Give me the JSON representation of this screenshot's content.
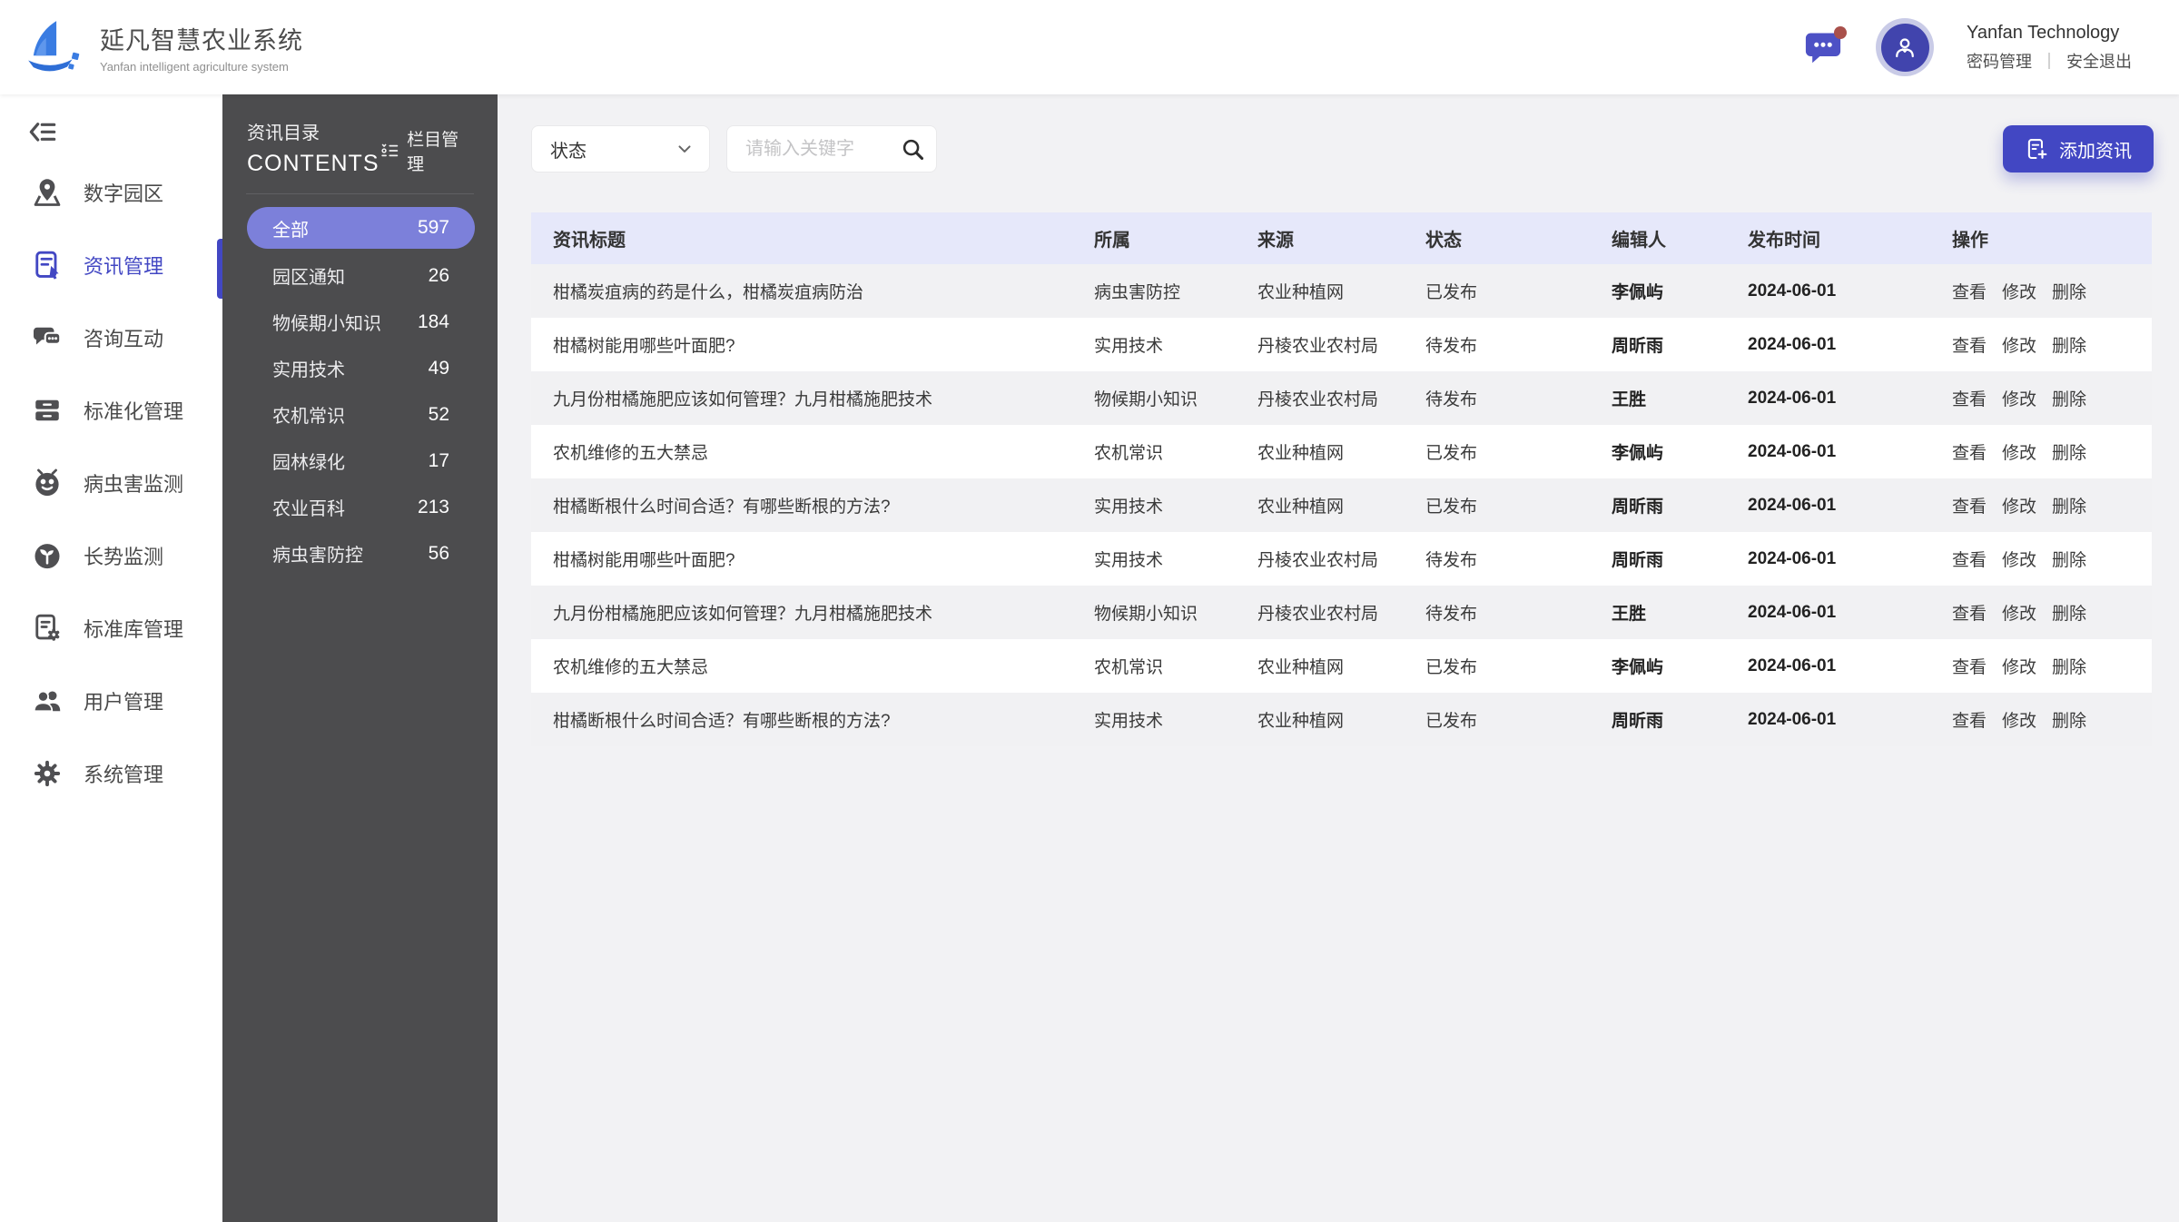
{
  "app": {
    "title": "延凡智慧农业系统",
    "subtitle": "Yanfan intelligent agriculture system",
    "company": "Yanfan Technology",
    "password_label": "密码管理",
    "separator": "｜",
    "logout_label": "安全退出",
    "message_icon": "message-icon",
    "avatar_icon": "user-avatar-icon"
  },
  "sidebar": {
    "collapse_icon": "collapse-menu-icon",
    "items": [
      {
        "label": "数字园区",
        "icon": "map-icon",
        "active": false
      },
      {
        "label": "资讯管理",
        "icon": "news-icon",
        "active": true
      },
      {
        "label": "咨询互动",
        "icon": "chat-icon",
        "active": false
      },
      {
        "label": "标准化管理",
        "icon": "archive-icon",
        "active": false
      },
      {
        "label": "病虫害监测",
        "icon": "bug-icon",
        "active": false
      },
      {
        "label": "长势监测",
        "icon": "sprout-icon",
        "active": false
      },
      {
        "label": "标准库管理",
        "icon": "doc-gear-icon",
        "active": false
      },
      {
        "label": "用户管理",
        "icon": "users-icon",
        "active": false
      },
      {
        "label": "系统管理",
        "icon": "gear-icon",
        "active": false
      }
    ]
  },
  "contents_panel": {
    "title_cn": "资讯目录",
    "title_en": "CONTENTS",
    "manage_label": "栏目管理",
    "manage_icon": "column-manage-icon",
    "categories": [
      {
        "label": "全部",
        "count": 597,
        "active": true
      },
      {
        "label": "园区通知",
        "count": 26,
        "active": false
      },
      {
        "label": "物候期小知识",
        "count": 184,
        "active": false
      },
      {
        "label": "实用技术",
        "count": 49,
        "active": false
      },
      {
        "label": "农机常识",
        "count": 52,
        "active": false
      },
      {
        "label": "园林绿化",
        "count": 17,
        "active": false
      },
      {
        "label": "农业百科",
        "count": 213,
        "active": false
      },
      {
        "label": "病虫害防控",
        "count": 56,
        "active": false
      }
    ]
  },
  "toolbar": {
    "status_filter": "状态",
    "search_placeholder": "请输入关键字",
    "search_icon": "search-icon",
    "add_button": "添加资讯",
    "add_icon": "add-doc-icon"
  },
  "table": {
    "columns": [
      "资讯标题",
      "所属",
      "来源",
      "状态",
      "编辑人",
      "发布时间",
      "操作"
    ],
    "actions": [
      "查看",
      "修改",
      "删除"
    ],
    "rows": [
      {
        "title": "柑橘炭疽病的药是什么，柑橘炭疽病防治",
        "category": "病虫害防控",
        "source": "农业种植网",
        "status": "已发布",
        "editor": "李佩屿",
        "date": "2024-06-01"
      },
      {
        "title": "柑橘树能用哪些叶面肥?",
        "category": "实用技术",
        "source": "丹棱农业农村局",
        "status": "待发布",
        "editor": "周昕雨",
        "date": "2024-06-01"
      },
      {
        "title": "九月份柑橘施肥应该如何管理？九月柑橘施肥技术",
        "category": "物候期小知识",
        "source": "丹棱农业农村局",
        "status": "待发布",
        "editor": "王胜",
        "date": "2024-06-01"
      },
      {
        "title": "农机维修的五大禁忌",
        "category": "农机常识",
        "source": "农业种植网",
        "status": "已发布",
        "editor": "李佩屿",
        "date": "2024-06-01"
      },
      {
        "title": "柑橘断根什么时间合适？有哪些断根的方法?",
        "category": "实用技术",
        "source": "农业种植网",
        "status": "已发布",
        "editor": "周昕雨",
        "date": "2024-06-01"
      },
      {
        "title": "柑橘树能用哪些叶面肥?",
        "category": "实用技术",
        "source": "丹棱农业农村局",
        "status": "待发布",
        "editor": "周昕雨",
        "date": "2024-06-01"
      },
      {
        "title": "九月份柑橘施肥应该如何管理？九月柑橘施肥技术",
        "category": "物候期小知识",
        "source": "丹棱农业农村局",
        "status": "待发布",
        "editor": "王胜",
        "date": "2024-06-01"
      },
      {
        "title": "农机维修的五大禁忌",
        "category": "农机常识",
        "source": "农业种植网",
        "status": "已发布",
        "editor": "李佩屿",
        "date": "2024-06-01"
      },
      {
        "title": "柑橘断根什么时间合适？有哪些断根的方法?",
        "category": "实用技术",
        "source": "农业种植网",
        "status": "已发布",
        "editor": "周昕雨",
        "date": "2024-06-01"
      }
    ]
  },
  "colors": {
    "accent": "#4247c3",
    "pill": "#7c80da",
    "panel_bg": "#4c4c4e",
    "table_header_bg": "#e6e8fa",
    "notification_dot": "#a9504b",
    "main_bg": "#f2f2f4"
  }
}
